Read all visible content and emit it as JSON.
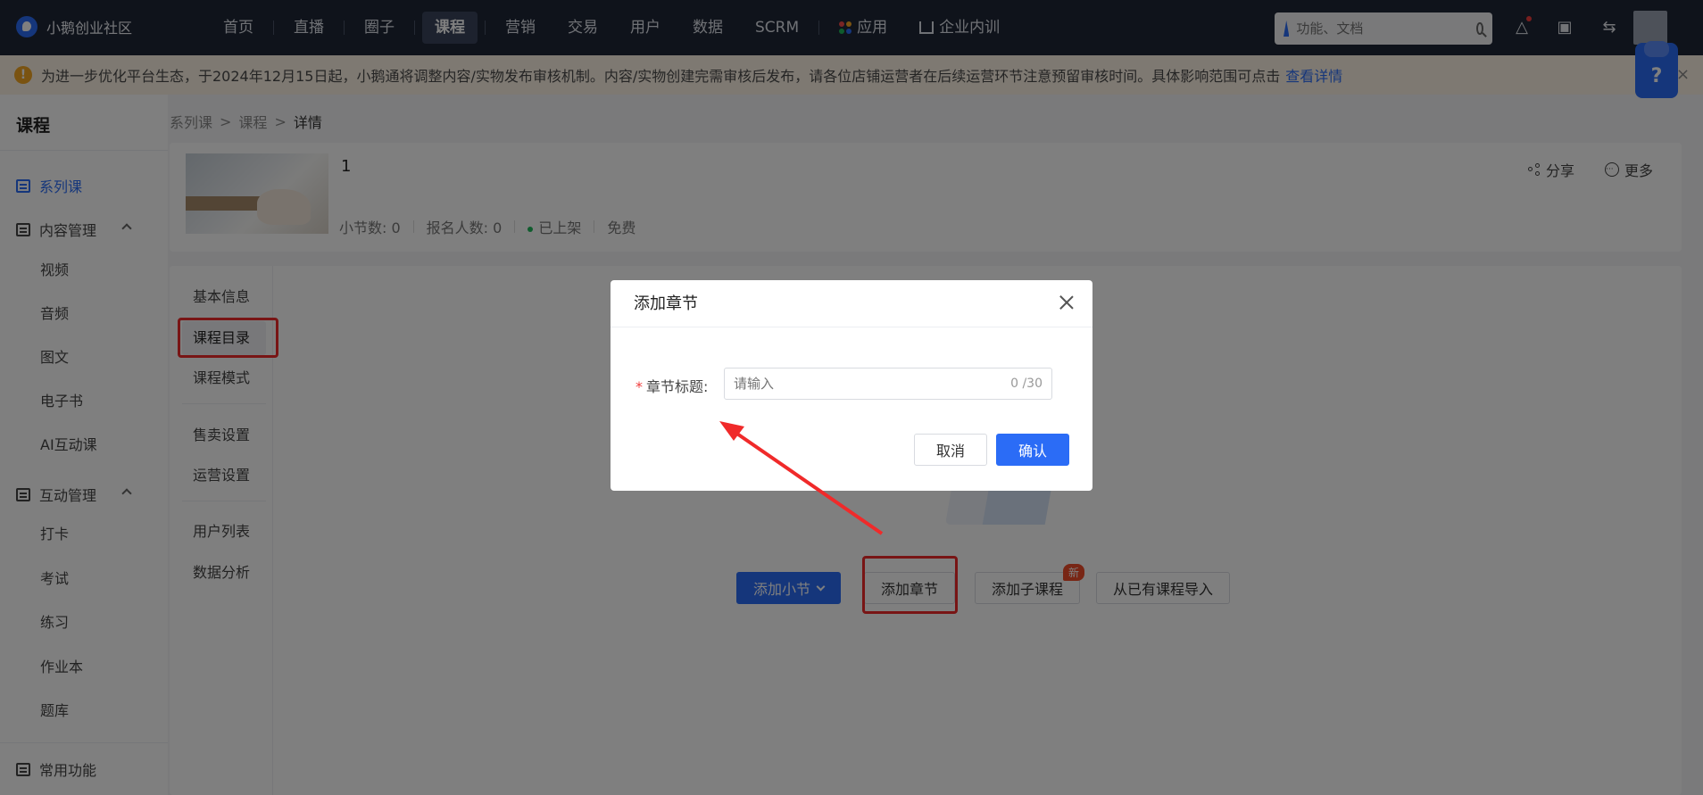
{
  "brand": {
    "name": "小鹅创业社区"
  },
  "nav": {
    "items": [
      "首页",
      "直播",
      "圈子",
      "课程",
      "营销",
      "交易",
      "用户",
      "数据",
      "SCRM"
    ],
    "apps": "应用",
    "training": "企业内训"
  },
  "search": {
    "placeholder": "功能、文档"
  },
  "notice": {
    "text": "为进一步优化平台生态，于2024年12月15日起，小鹅通将调整内容/实物发布审核机制。内容/实物创建完需审核后发布，请各位店铺运营者在后续运营环节注意预留审核时间。具体影响范围可点击",
    "link": "查看详情",
    "close": "×"
  },
  "help": {
    "label": "?"
  },
  "sidebar": {
    "title": "课程",
    "series": "系列课",
    "content_group": "内容管理",
    "content_items": [
      "视频",
      "音频",
      "图文",
      "电子书",
      "AI互动课"
    ],
    "interact_group": "互动管理",
    "interact_items": [
      "打卡",
      "考试",
      "练习",
      "作业本",
      "题库"
    ],
    "common": "常用功能"
  },
  "breadcrumb": {
    "items": [
      "系列课",
      "课程",
      "详情"
    ],
    "sep": ">"
  },
  "course": {
    "title": "1",
    "lessons": "小节数: 0",
    "enrolled": "报名人数: 0",
    "status": "已上架",
    "price": "免费",
    "share": "分享",
    "more": "更多"
  },
  "tabs": {
    "basic": "基本信息",
    "catalog": "课程目录",
    "mode": "课程模式",
    "sale": "售卖设置",
    "ops": "运营设置",
    "users": "用户列表",
    "analytics": "数据分析"
  },
  "actions": {
    "add_lesson": "添加小节",
    "add_chapter": "添加章节",
    "add_sub": "添加子课程",
    "new_badge": "新",
    "import": "从已有课程导入"
  },
  "modal": {
    "title": "添加章节",
    "label": "章节标题:",
    "required": "*",
    "placeholder": "请输入",
    "count": "0 /30",
    "cancel": "取消",
    "confirm": "确认"
  },
  "colors": {
    "accent": "#2b6cf6",
    "highlight": "#f02a2a",
    "topbar": "#1f2637"
  }
}
